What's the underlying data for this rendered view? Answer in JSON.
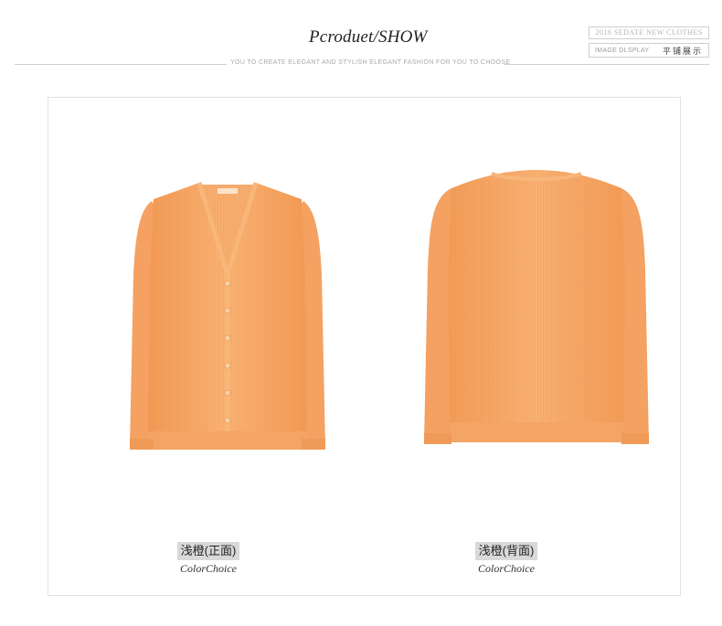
{
  "header": {
    "title": "Pcroduet/SHOW",
    "subtitle": "YOU TO CREATE ELEGANT AND STYLISH ELEGANT FASHION FOR YOU TO CHOOSE",
    "badge_top": "2016 SEDATE NEW CLOTHES",
    "badge_bottom_en": "IMAGE DLSPLAY",
    "badge_bottom_zh": "平铺展示"
  },
  "colors": {
    "garment": "#f7a866",
    "garment_shadow": "#ee9450",
    "garment_light": "#fbbd83",
    "label_bg": "#d9d9d9"
  },
  "products": [
    {
      "view": "front",
      "label_cn": "浅橙(正面)",
      "label_en": "ColorChoice",
      "image_icon": "cardigan-front-image"
    },
    {
      "view": "back",
      "label_cn": "浅橙(背面)",
      "label_en": "ColorChoice",
      "image_icon": "cardigan-back-image"
    }
  ]
}
